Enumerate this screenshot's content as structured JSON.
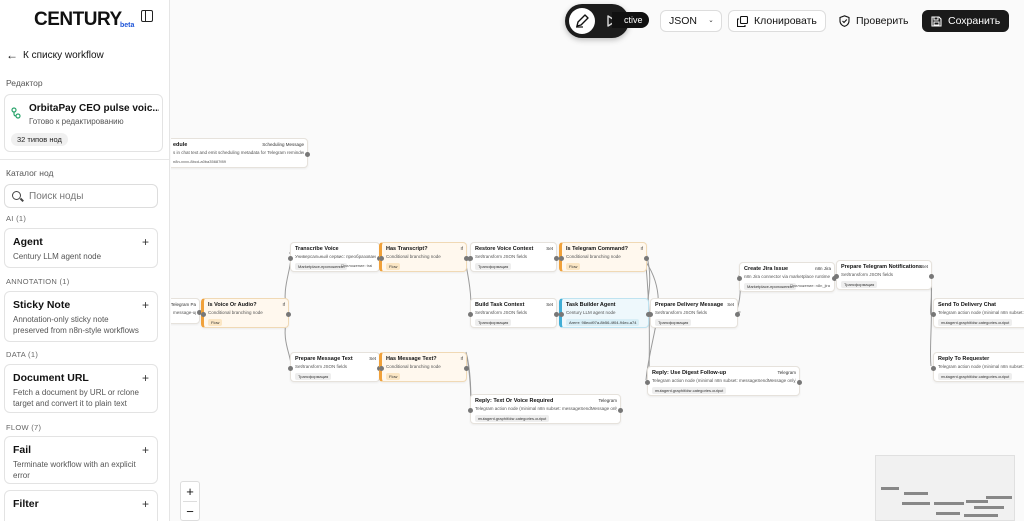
{
  "brand": {
    "name": "CENTURY",
    "tag": "beta"
  },
  "sidebar": {
    "back_label": "К списку workflow",
    "editor_label": "Редактор",
    "workflow": {
      "title": "OrbitaPay CEO pulse voic...",
      "status": "Готово к редактированию",
      "badge": "32 типов нод"
    },
    "catalog_label": "Каталог нод",
    "search_placeholder": "Поиск ноды",
    "categories": [
      {
        "label": "AI (1)",
        "nodes": [
          {
            "name": "Agent",
            "desc": "Century LLM agent node"
          }
        ]
      },
      {
        "label": "ANNOTATION (1)",
        "nodes": [
          {
            "name": "Sticky Note",
            "desc": "Annotation-only sticky note preserved from n8n-style workflows"
          }
        ]
      },
      {
        "label": "DATA (1)",
        "nodes": [
          {
            "name": "Document URL",
            "desc": "Fetch a document by URL or rclone target and convert it to plain text"
          }
        ]
      },
      {
        "label": "FLOW (7)",
        "nodes": [
          {
            "name": "Fail",
            "desc": "Terminate workflow with an explicit error"
          },
          {
            "name": "Filter",
            "desc": ""
          }
        ]
      }
    ]
  },
  "toolbar": {
    "active_label": "ctive",
    "format_label": "JSON",
    "clone_label": "Клонировать",
    "check_label": "Проверить",
    "save_label": "Сохранить"
  },
  "colors": {
    "accent_dark": "#1a1a1a",
    "branch_orange": "#f0a13a",
    "agent_teal": "#40aed6",
    "beta_blue": "#1e55d8"
  },
  "canvas": {
    "nodes": [
      {
        "id": "schedule",
        "title": "edule",
        "tag": "Scheduling Message",
        "desc": "s in chat text and emit scheduling metadata for Telegram reminder",
        "chip": "",
        "chip2": "n8n-xxxx-8bcd-a0ba35687f89",
        "style": "plain"
      },
      {
        "id": "transcribe",
        "title": "Transcribe Voice",
        "tag": "",
        "desc": "Универсальный сервис: преобразование текста",
        "chip": "Marketplace-приложение",
        "chip2": "Приложение: trai",
        "style": "plain"
      },
      {
        "id": "has_transcript",
        "title": "Has Transcript?",
        "tag": "If",
        "desc": "Conditional branching node",
        "chip": "Flow",
        "chip2": "",
        "style": "orange"
      },
      {
        "id": "restore",
        "title": "Restore Voice Context",
        "tag": "Set",
        "desc": "Set/transform JSON fields",
        "chip": "Трансформация",
        "chip2": "",
        "style": "plain"
      },
      {
        "id": "is_cmd",
        "title": "Is Telegram Command?",
        "tag": "If",
        "desc": "Conditional branching node",
        "chip": "Flow",
        "chip2": "",
        "style": "orange"
      },
      {
        "id": "tg_in",
        "title": "",
        "tag": "Telegram Pa",
        "desc": "message-up",
        "chip": "",
        "chip2": "",
        "style": "plain"
      },
      {
        "id": "is_voice",
        "title": "Is Voice Or Audio?",
        "tag": "If",
        "desc": "Conditional branching node",
        "chip": "Flow",
        "chip2": "",
        "style": "orange"
      },
      {
        "id": "build_task",
        "title": "Build Task Context",
        "tag": "Set",
        "desc": "Set/transform JSON fields",
        "chip": "Трансформация",
        "chip2": "",
        "style": "plain"
      },
      {
        "id": "task_agent",
        "title": "Task Builder Agent",
        "tag": "",
        "desc": "Century LLM agent node",
        "chip": "Агент: 98ecd97a-8b56-4f04-94ec-a74",
        "chip2": "",
        "style": "teal"
      },
      {
        "id": "prepare_delivery",
        "title": "Prepare Delivery Message",
        "tag": "Set",
        "desc": "Set/transform JSON fields",
        "chip": "Трансформация",
        "chip2": "",
        "style": "plain"
      },
      {
        "id": "jira",
        "title": "Create Jira Issue",
        "tag": "n8n Jira",
        "desc": "n8n Jira connector via marketplace runtime",
        "chip": "Marketplace-приложение",
        "chip2": "Приложение: n8n_jira",
        "style": "plain"
      },
      {
        "id": "prepare_notif",
        "title": "Prepare Telegram Notifications",
        "tag": "Set",
        "desc": "Set/transform JSON fields",
        "chip": "Трансформация",
        "chip2": "",
        "style": "plain"
      },
      {
        "id": "send_chat",
        "title": "Send To Delivery Chat",
        "tag": "",
        "desc": "Telegram action node (minimal n8n subset: messa",
        "chip": "mutagent.graphit/dsr.categories.output",
        "chip2": "",
        "style": "plain"
      },
      {
        "id": "reply_req",
        "title": "Reply To Requester",
        "tag": "",
        "desc": "Telegram action node (minimal n8n subset: messa",
        "chip": "mutagent.graphit/dsr.categories.output",
        "chip2": "",
        "style": "plain"
      },
      {
        "id": "prep_msg",
        "title": "Prepare Message Text",
        "tag": "Set",
        "desc": "Set/transform JSON fields",
        "chip": "Трансформация",
        "chip2": "",
        "style": "plain"
      },
      {
        "id": "has_msg",
        "title": "Has Message Text?",
        "tag": "If",
        "desc": "Conditional branching node",
        "chip": "Flow",
        "chip2": "",
        "style": "orange"
      },
      {
        "id": "digest",
        "title": "Reply: Use Digest Follow-up",
        "tag": "Telegram",
        "desc": "Telegram action node (minimal n8n subset: messageSendMessage only)",
        "chip": "mutagent.graphit/dsr.categories.output",
        "chip2": "",
        "style": "plain"
      },
      {
        "id": "text_req",
        "title": "Reply: Text Or Voice Required",
        "tag": "Telegram",
        "desc": "Telegram action node (minimal n8n subset: messageSendMessage only)",
        "chip": "mutagent.graphit/dsr.categories.output",
        "chip2": "",
        "style": "plain"
      }
    ]
  },
  "zoom": {
    "in": "+",
    "out": "−"
  }
}
